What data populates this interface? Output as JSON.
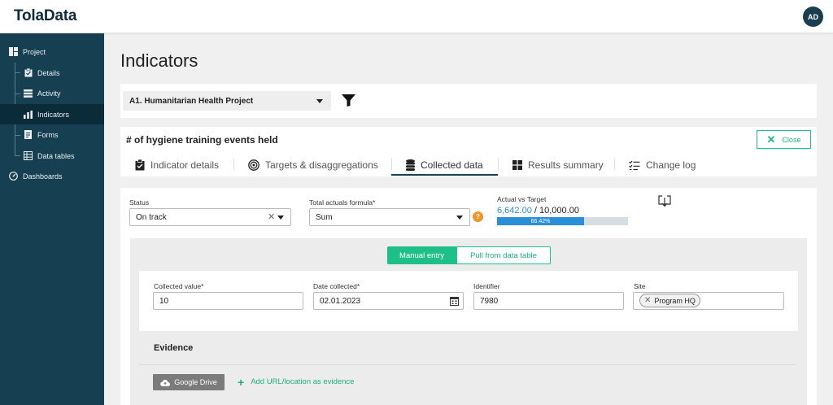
{
  "app": {
    "logo": "TolaData",
    "avatar_initials": "AD"
  },
  "sidebar": {
    "items": [
      {
        "label": "Project",
        "icon": "project-icon"
      },
      {
        "label": "Details",
        "icon": "clipboard-icon"
      },
      {
        "label": "Activity",
        "icon": "list-icon"
      },
      {
        "label": "Indicators",
        "icon": "bar-chart-icon",
        "active": true
      },
      {
        "label": "Forms",
        "icon": "form-icon"
      },
      {
        "label": "Data tables",
        "icon": "table-icon"
      },
      {
        "label": "Dashboards",
        "icon": "dashboard-icon"
      }
    ]
  },
  "page": {
    "title": "Indicators"
  },
  "filter": {
    "project": "A1. Humanitarian Health Project",
    "filter_icon": "filter-icon"
  },
  "indicator": {
    "title": "# of hygiene training events held",
    "close_label": "Close"
  },
  "tabs": [
    {
      "label": "Indicator details",
      "icon": "clipboard-icon"
    },
    {
      "label": "Targets & disaggregations",
      "icon": "target-icon"
    },
    {
      "label": "Collected data",
      "icon": "database-icon",
      "active": true
    },
    {
      "label": "Results summary",
      "icon": "grid-icon"
    },
    {
      "label": "Change log",
      "icon": "change-log-icon"
    }
  ],
  "status": {
    "label": "Status",
    "value": "On track"
  },
  "formula": {
    "label": "Total actuals formula*",
    "value": "Sum",
    "help": "?"
  },
  "actual_vs_target": {
    "label": "Actual vs Target",
    "actual": "6,642.00",
    "target": "/ 10,000.00",
    "percent_label": "66.42%",
    "percent": 66.42
  },
  "entry_mode": {
    "manual": "Manual entry",
    "pull": "Pull from data table"
  },
  "form": {
    "collected_value_label": "Collected value*",
    "collected_value": "10",
    "date_label": "Date collected*",
    "date": "02.01.2023",
    "identifier_label": "Identifier",
    "identifier": "7980",
    "site_label": "Site",
    "site_chip": "Program HQ"
  },
  "evidence": {
    "title": "Evidence",
    "gdrive_label": "Google Drive",
    "add_url_label": "Add URL/location as evidence"
  },
  "colors": {
    "sidebar": "#163f51",
    "accent_green": "#1fc088",
    "progress_blue": "#2b8fd6",
    "help_orange": "#f0932b"
  }
}
